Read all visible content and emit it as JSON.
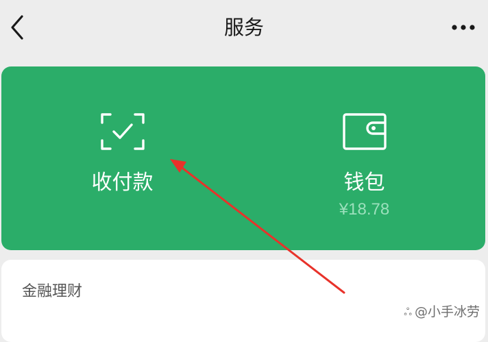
{
  "header": {
    "title": "服务",
    "back_icon": "chevron-left-icon",
    "more_icon": "more-horizontal-icon"
  },
  "wallet_card": {
    "background_color": "#2bad69",
    "items": [
      {
        "label": "收付款",
        "icon": "scan-check-icon"
      },
      {
        "label": "钱包",
        "sub": "¥18.78",
        "icon": "wallet-icon"
      }
    ]
  },
  "sections": [
    {
      "title": "金融理财"
    }
  ],
  "annotation": {
    "type": "arrow",
    "color": "#e8322a",
    "points_to": "收付款"
  },
  "watermark": {
    "glyph": "ஃ",
    "text": "@小手冰劳"
  }
}
